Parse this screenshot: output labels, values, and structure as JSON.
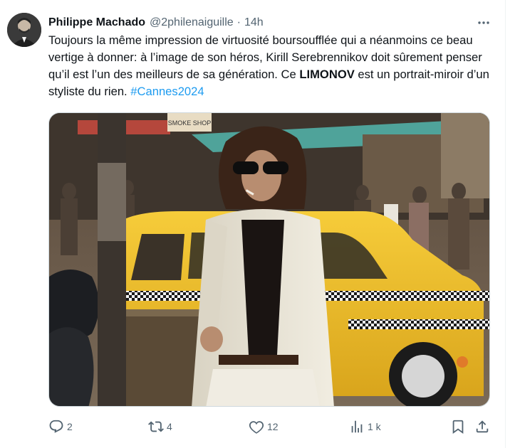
{
  "tweet": {
    "author_name": "Philippe Machado",
    "handle": "@2philenaiguille",
    "separator": "·",
    "time": "14h",
    "text_1": "Toujours la même impression de virtuosité boursoufflée qui a néanmoins ce beau vertige à donner: à l’image de son héros, Kirill Serebrennikov doit sûrement penser qu’il est l’un des meilleurs de sa génération. Ce ",
    "text_bold": "LIMONOV",
    "text_2": " est un portrait-miroir d’un styliste du rien. ",
    "hashtag": "#Cannes2024",
    "media_signs": {
      "smoke_shop": "SMOKE SHOP"
    }
  },
  "actions": {
    "replies": "2",
    "reposts": "4",
    "likes": "12",
    "views": "1 k"
  },
  "icons": {
    "more": "more-horizontal-icon",
    "reply": "reply-icon",
    "repost": "repost-icon",
    "like": "heart-icon",
    "views": "views-bar-chart-icon",
    "bookmark": "bookmark-icon",
    "share": "share-icon"
  },
  "colors": {
    "text": "#0f1419",
    "secondary": "#536471",
    "link": "#1d9bf0",
    "border": "#cfd9de",
    "taxi_yellow": "#f2c230"
  }
}
